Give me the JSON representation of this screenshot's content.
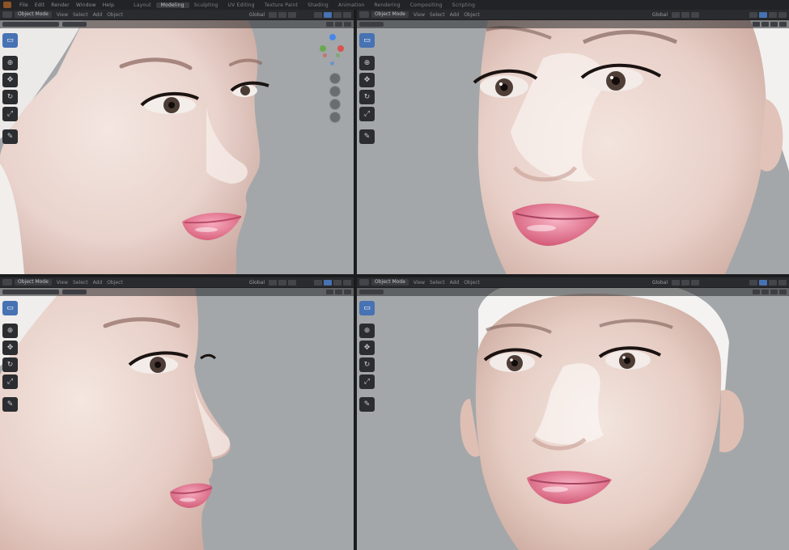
{
  "app": {
    "menus": [
      "File",
      "Edit",
      "Render",
      "Window",
      "Help"
    ],
    "workspaces": [
      "Layout",
      "Modeling",
      "Sculpting",
      "UV Editing",
      "Texture Paint",
      "Shading",
      "Animation",
      "Rendering",
      "Compositing",
      "Scripting"
    ],
    "active_workspace": "Modeling"
  },
  "viewports": {
    "tl": {
      "mode": "Object Mode",
      "menus": [
        "View",
        "Select",
        "Add",
        "Object"
      ],
      "orientation": "Global"
    },
    "tr": {
      "mode": "Object Mode",
      "menus": [
        "View",
        "Select",
        "Add",
        "Object"
      ],
      "orientation": "Global"
    },
    "bl": {
      "mode": "Object Mode",
      "menus": [
        "View",
        "Select",
        "Add",
        "Object"
      ],
      "orientation": "Global"
    },
    "br": {
      "mode": "Object Mode",
      "menus": [
        "View",
        "Select",
        "Add",
        "Object"
      ],
      "orientation": "Global"
    }
  },
  "toolbar_icons": [
    "select-box-icon",
    "cursor-icon",
    "move-icon",
    "rotate-icon",
    "scale-icon",
    "transform-icon",
    "annotate-icon",
    "measure-icon"
  ],
  "colors": {
    "accent": "#4772b3",
    "viewport_bg": "#a3a7a9",
    "header_bg": "#2a2b2e",
    "gizmo_x": "#d9534f",
    "gizmo_y": "#6aa84f",
    "gizmo_z": "#4a86e8"
  }
}
